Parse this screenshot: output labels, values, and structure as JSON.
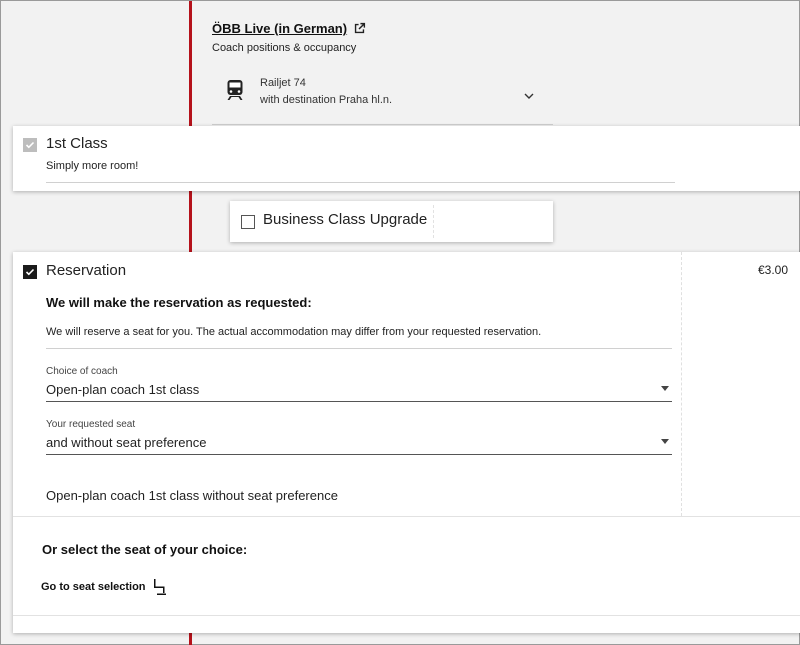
{
  "live": {
    "title": "ÖBB Live (in German)",
    "subtitle": "Coach positions & occupancy",
    "train_name": "Railjet 74",
    "train_destination": "with destination Praha hl.n."
  },
  "first_class": {
    "label": "1st Class",
    "subtitle": "Simply more room!",
    "checked": true,
    "disabled": true
  },
  "business": {
    "label": "Business Class Upgrade",
    "checked": false
  },
  "reservation": {
    "label": "Reservation",
    "price": "€3.00",
    "checked": true,
    "heading": "We will make the reservation as requested:",
    "description": "We will reserve a seat for you. The actual accommodation may differ from your requested reservation.",
    "coach_label": "Choice of coach",
    "coach_value": "Open-plan coach 1st class",
    "seat_label": "Your requested seat",
    "seat_value": "and without seat preference",
    "summary": "Open-plan coach 1st class without seat preference",
    "or_heading": "Or select the seat of your choice:",
    "goto_label": "Go to seat selection"
  },
  "colors": {
    "accent_red": "#b5121b",
    "checkbox_checked": "#1b1b1b",
    "checkbox_disabled": "#bdbdbd"
  },
  "icons": [
    "external-link-icon",
    "train-icon",
    "chevron-down-icon",
    "checkmark-icon",
    "seat-icon",
    "dropdown-caret-icon"
  ]
}
